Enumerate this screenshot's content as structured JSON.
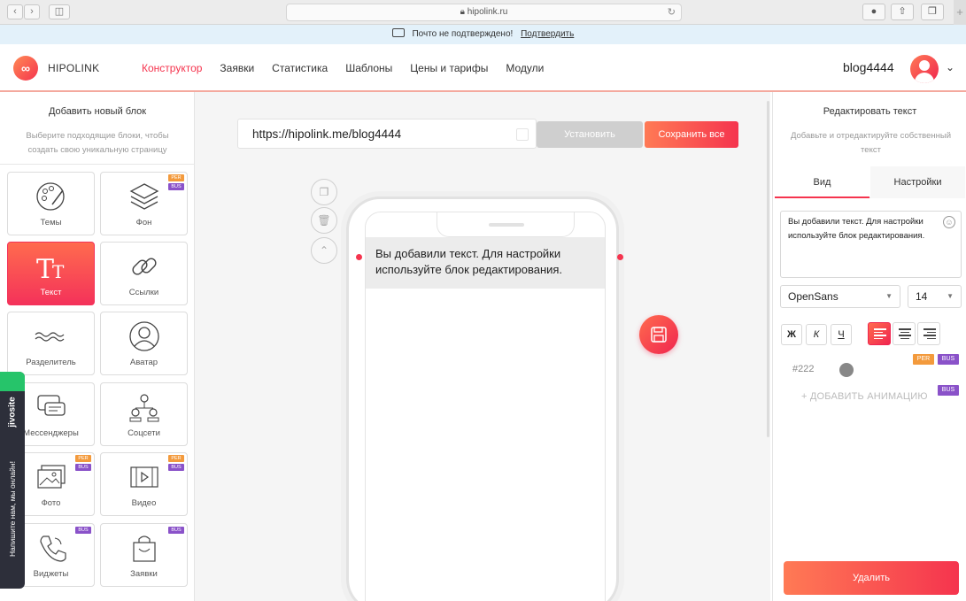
{
  "browser": {
    "url": "hipolink.ru",
    "back_icon": "chevron-left-icon",
    "forward_icon": "chevron-right-icon"
  },
  "notice": {
    "text": "Почто не подтверждено!",
    "link": "Подтвердить"
  },
  "header": {
    "logo_text": "HIPOLINK",
    "menu": [
      "Конструктор",
      "Заявки",
      "Статистика",
      "Шаблоны",
      "Цены и тарифы",
      "Модули"
    ],
    "active_menu": "Конструктор",
    "username": "blog4444"
  },
  "left_panel": {
    "title": "Добавить новый блок",
    "subtitle": "Выберите подходящие блоки, чтобы создать свою уникальную страницу",
    "tiles": [
      {
        "label": "Темы",
        "icon": "palette-icon",
        "badges": []
      },
      {
        "label": "Фон",
        "icon": "layers-icon",
        "badges": [
          "PER",
          "BUS"
        ]
      },
      {
        "label": "Текст",
        "icon": "text-icon",
        "badges": [],
        "active": true
      },
      {
        "label": "Ссылки",
        "icon": "link-icon",
        "badges": []
      },
      {
        "label": "Разделитель",
        "icon": "wave-divider-icon",
        "badges": []
      },
      {
        "label": "Аватар",
        "icon": "avatar-icon",
        "badges": []
      },
      {
        "label": "Мессенджеры",
        "icon": "chat-icon",
        "badges": []
      },
      {
        "label": "Соцсети",
        "icon": "social-network-icon",
        "badges": []
      },
      {
        "label": "Фото",
        "icon": "photo-icon",
        "badges": [
          "PER",
          "BUS"
        ]
      },
      {
        "label": "Видео",
        "icon": "video-icon",
        "badges": [
          "PER",
          "BUS"
        ]
      },
      {
        "label": "Виджеты",
        "icon": "phone-icon",
        "badges": [
          "BUS"
        ]
      },
      {
        "label": "Заявки",
        "icon": "shopping-bag-icon",
        "badges": [
          "BUS"
        ]
      }
    ]
  },
  "center": {
    "page_url": "https://hipolink.me/blog4444",
    "install_label": "Установить",
    "save_all_label": "Сохранить все",
    "block_text": "Вы добавили текст. Для настройки используйте блок редактирования."
  },
  "right_panel": {
    "title": "Редактировать текст",
    "subtitle": "Добавьте и отредактируйте собственный текст",
    "tabs": [
      "Вид",
      "Настройки"
    ],
    "text_value": "Вы добавили текст. Для настройки используйте блок редактирования.",
    "font": "OpenSans",
    "font_size": "14",
    "bold": "Ж",
    "italic": "К",
    "underline": "Ч",
    "color_value": "#222",
    "badge_per": "PER",
    "badge_bus": "BUS",
    "add_animation": "+ ДОБАВИТЬ АНИМАЦИЮ",
    "delete_label": "Удалить"
  },
  "chat_widget": {
    "brand": "jivosite",
    "message": "Напишите нам, мы онлайн!"
  },
  "colors": {
    "accent": "#f5344e",
    "accent_light": "#ff7a55",
    "badge_per": "#f39a3c",
    "badge_bus": "#8a52c9"
  }
}
